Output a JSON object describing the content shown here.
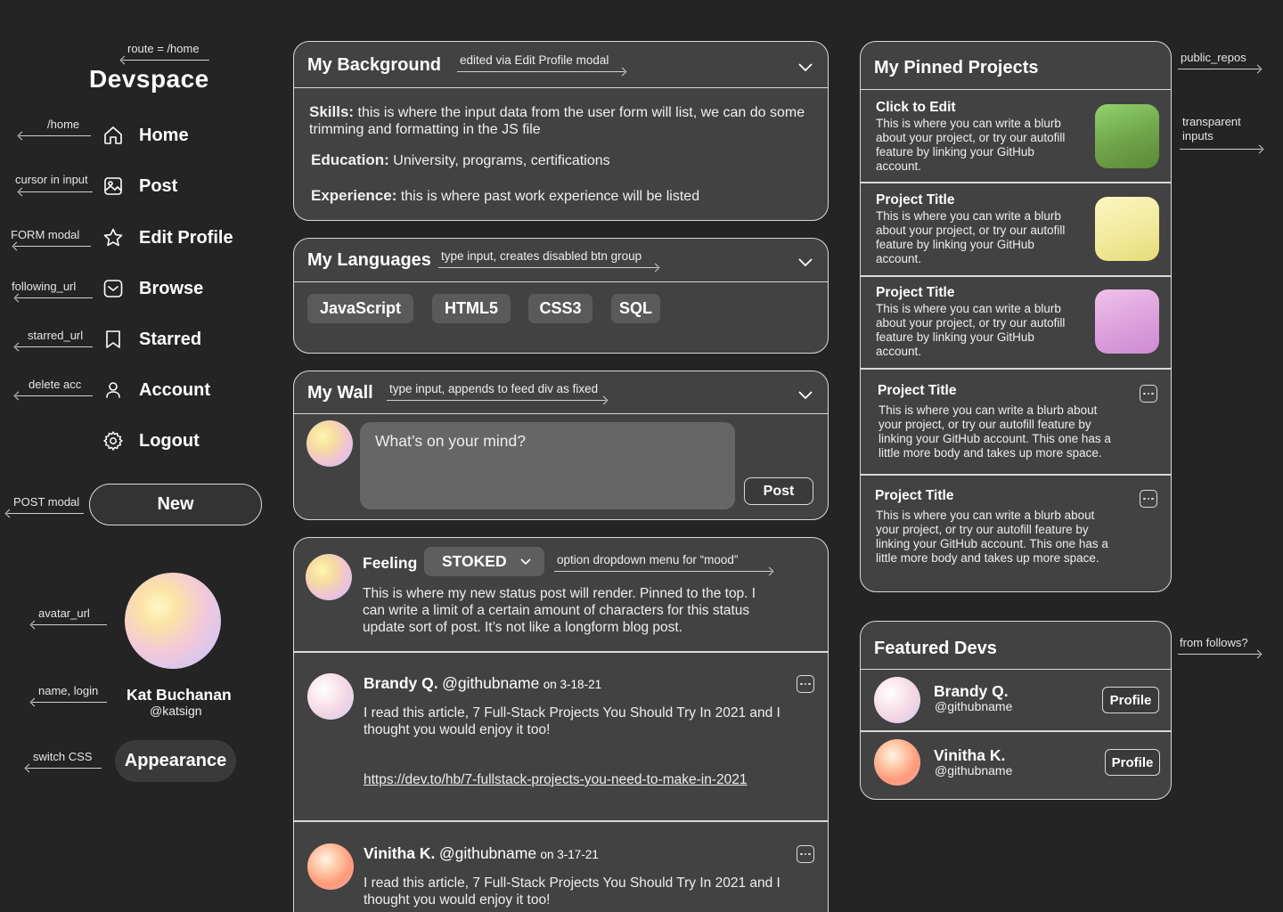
{
  "sidebar": {
    "logo": "Devspace",
    "logo_note": "route = /home",
    "nav": [
      {
        "label": "Home",
        "note": "/home",
        "icon": "home-icon"
      },
      {
        "label": "Post",
        "note": "cursor in input",
        "icon": "image-icon"
      },
      {
        "label": "Edit Profile",
        "note": "FORM modal",
        "icon": "star-icon"
      },
      {
        "label": "Browse",
        "note": "following_url",
        "icon": "inbox-icon"
      },
      {
        "label": "Starred",
        "note": "starred_url",
        "icon": "bookmark-icon"
      },
      {
        "label": "Account",
        "note": "delete acc",
        "icon": "user-icon"
      },
      {
        "label": "Logout",
        "note": "",
        "icon": "gear-icon"
      }
    ],
    "new_button": "New",
    "new_note": "POST modal",
    "avatar_note": "avatar_url",
    "name_note": "name, login",
    "user_name": "Kat Buchanan",
    "user_login": "@katsign",
    "appearance_button": "Appearance",
    "appearance_note": "switch CSS"
  },
  "background": {
    "title": "My Background",
    "note": "edited via Edit Profile modal",
    "skills_label": "Skills:",
    "skills_text": " this is where the input data from the user form will list, we can do some trimming and formatting in the JS file",
    "education_label": "Education:",
    "education_text": " University, programs, certifications",
    "experience_label": "Experience:",
    "experience_text": " this is where past work experience will be listed"
  },
  "languages": {
    "title": "My Languages",
    "note": "type input, creates disabled btn group",
    "items": [
      "JavaScript",
      "HTML5",
      "CSS3",
      "SQL"
    ]
  },
  "wall": {
    "title": "My Wall",
    "note": "type input, appends to feed div as fixed",
    "placeholder": "What’s on your mind?",
    "post_button": "Post"
  },
  "status": {
    "feeling_label": "Feeling",
    "mood": "STOKED",
    "mood_note": "option dropdown menu for “mood”",
    "text": "This is where my new status post will render. Pinned to the top. I can write a limit of a certain amount of characters for this status update sort of post. It’s not like a longform blog post."
  },
  "feed": [
    {
      "name": "Brandy Q.",
      "handle": "@githubname",
      "date": "on 3-18-21",
      "text": "I read this article, 7 Full-Stack Projects You Should Try In 2021 and I thought you would enjoy it too!",
      "link": "https://dev.to/hb/7-fullstack-projects-you-need-to-make-in-2021"
    },
    {
      "name": "Vinitha K.",
      "handle": "@githubname",
      "date": "on 3-17-21",
      "text": "I read this article, 7 Full-Stack Projects You Should Try In 2021 and I thought you would enjoy it too!"
    }
  ],
  "pinned": {
    "title": "My Pinned Projects",
    "note": "public_repos",
    "side_note": "transparent inputs",
    "items": [
      {
        "title": "Click to Edit",
        "text": "This is where you can write a blurb about your project, or try our autofill feature by linking your GitHub account."
      },
      {
        "title": "Project Title",
        "text": "This is where you can write a blurb about your project, or try our autofill feature by linking your GitHub account."
      },
      {
        "title": "Project Title",
        "text": "This is where you can write a blurb about your project, or try our autofill feature by linking your GitHub account."
      },
      {
        "title": "Project Title",
        "text": "This is where you can write a blurb about your project, or try our autofill feature by linking your GitHub account. This one has a little more body and takes up more space."
      },
      {
        "title": "Project Title",
        "text": "This is where you can write a blurb about your project, or try our autofill feature by linking your GitHub account. This one has a little more body and takes up more space."
      }
    ]
  },
  "featured": {
    "title": "Featured Devs",
    "note": "from follows?",
    "devs": [
      {
        "name": "Brandy Q.",
        "handle": "@githubname",
        "button": "Profile"
      },
      {
        "name": "Vinitha K.",
        "handle": "@githubname",
        "button": "Profile"
      }
    ]
  },
  "colors": {
    "background": "#242424",
    "panel": "#424242",
    "border": "#d9d9d9"
  }
}
